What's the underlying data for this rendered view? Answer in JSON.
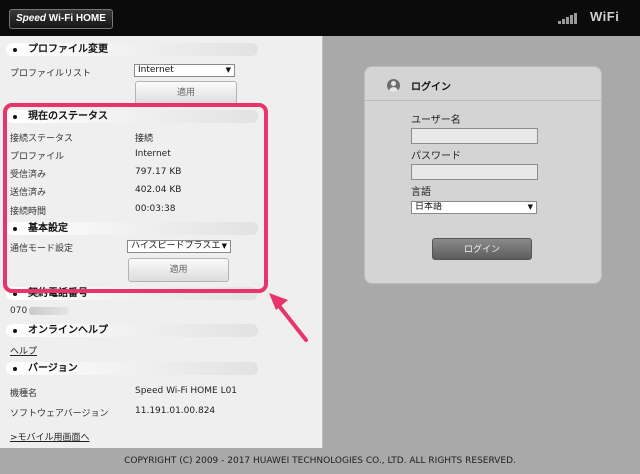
{
  "header": {
    "logo_speed": "Speed",
    "logo_rest": " Wi-Fi HOME",
    "wifi_label": "WiFi"
  },
  "profile_change": {
    "title": "プロファイル変更",
    "list_label": "プロファイルリスト",
    "list_selected": "Internet",
    "apply": "適用"
  },
  "status": {
    "title": "現在のステータス",
    "rows": [
      {
        "label": "接続ステータス",
        "value": "接続"
      },
      {
        "label": "プロファイル",
        "value": "Internet"
      },
      {
        "label": "受信済み",
        "value": "797.17 KB"
      },
      {
        "label": "送信済み",
        "value": "402.04 KB"
      },
      {
        "label": "接続時間",
        "value": "00:03:38"
      }
    ]
  },
  "basic": {
    "title": "基本設定",
    "mode_label": "通信モード設定",
    "mode_selected": "ハイスピードプラスエ",
    "apply": "適用"
  },
  "contract": {
    "title": "契約電話番号",
    "number_prefix": "070"
  },
  "help": {
    "title": "オンラインヘルプ",
    "link": "ヘルプ"
  },
  "version": {
    "title": "バージョン",
    "rows": [
      {
        "label": "機種名",
        "value": "Speed Wi-Fi HOME L01"
      },
      {
        "label": "ソフトウェアバージョン",
        "value": "11.191.01.00.824"
      }
    ],
    "mobile_link": ">モバイル用画面へ"
  },
  "login": {
    "title": "ログイン",
    "username_label": "ユーザー名",
    "username_value": "",
    "password_label": "パスワード",
    "password_value": "",
    "language_label": "言語",
    "language_selected": "日本語",
    "submit": "ログイン"
  },
  "footer": {
    "copyright": "COPYRIGHT (C) 2009 - 2017 HUAWEI TECHNOLOGIES CO., LTD. ALL RIGHTS RESERVED."
  },
  "colors": {
    "highlight": "#e8336b",
    "header_bg": "#0b0b0b",
    "page_bg": "#a9a9a9"
  },
  "icons": {
    "signal": "signal-strength-icon",
    "user": "user-icon",
    "dropdown": "chevron-down-icon"
  }
}
